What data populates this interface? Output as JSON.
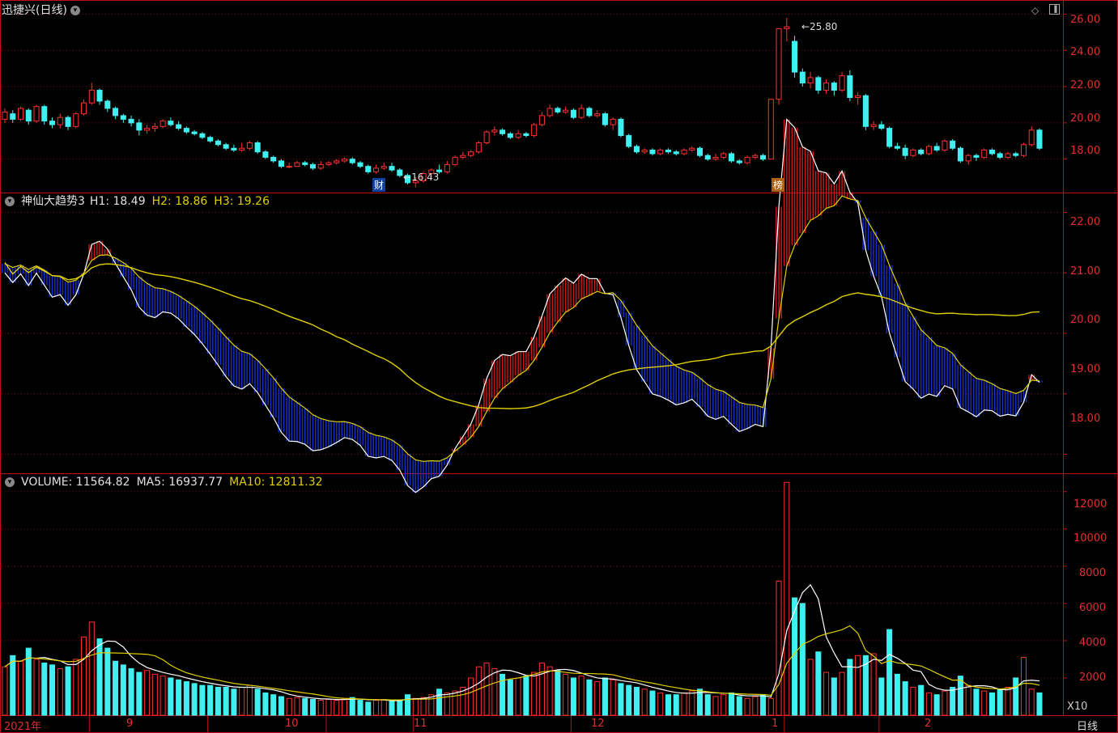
{
  "panel1": {
    "title": "迅捷兴(日线)",
    "high_label": "25.80",
    "low_label": "16.43",
    "markers": [
      {
        "label": "财",
        "color": "#2060c0"
      },
      {
        "label": "榜",
        "color": "#c07020"
      }
    ],
    "yticks": [
      "26.00",
      "24.00",
      "22.00",
      "20.00",
      "18.00"
    ]
  },
  "panel2": {
    "title": "神仙大趋势3",
    "h1_label": "H1: 18.49",
    "h2_label": "H2: 18.86",
    "h3_label": "H3: 19.26",
    "yticks": [
      "22.00",
      "21.00",
      "20.00",
      "19.00",
      "18.00"
    ]
  },
  "panel3": {
    "vol_label": "VOLUME: 11564.82",
    "ma5_label": "MA5: 16937.77",
    "ma10_label": "MA10: 12811.32",
    "yticks": [
      "12000",
      "10000",
      "8000",
      "6000",
      "4000",
      "2000"
    ],
    "unit": "X10"
  },
  "xaxis": {
    "labels": [
      "2021年",
      "9",
      "10",
      "11",
      "12",
      "1",
      "2"
    ],
    "period": "日线"
  },
  "colors": {
    "up": "#ff3030",
    "down": "#40f0f0",
    "ma10": "#e0d000",
    "grid": "#801010",
    "axis": "#c01010"
  },
  "chart_data": {
    "type": "candlestick",
    "candles": [
      [
        20.2,
        20.6,
        20.8,
        20.0
      ],
      [
        20.5,
        20.2,
        20.7,
        20.0
      ],
      [
        20.2,
        20.8,
        20.9,
        20.1
      ],
      [
        20.7,
        20.1,
        20.8,
        19.9
      ],
      [
        20.1,
        20.9,
        21.0,
        20.0
      ],
      [
        20.9,
        20.1,
        21.0,
        19.9
      ],
      [
        20.1,
        19.9,
        20.3,
        19.7
      ],
      [
        19.9,
        20.3,
        20.5,
        19.7
      ],
      [
        20.3,
        19.8,
        20.4,
        19.6
      ],
      [
        19.8,
        20.5,
        20.6,
        19.7
      ],
      [
        20.5,
        21.1,
        21.3,
        20.4
      ],
      [
        21.1,
        21.8,
        22.2,
        21.0
      ],
      [
        21.8,
        21.2,
        21.9,
        21.0
      ],
      [
        21.2,
        20.8,
        21.3,
        20.6
      ],
      [
        20.8,
        20.4,
        20.9,
        20.2
      ],
      [
        20.4,
        20.2,
        20.5,
        20.0
      ],
      [
        20.2,
        20.0,
        20.4,
        19.8
      ],
      [
        20.0,
        19.6,
        20.2,
        19.3
      ],
      [
        19.6,
        19.7,
        19.9,
        19.4
      ],
      [
        19.7,
        19.8,
        20.0,
        19.5
      ],
      [
        19.8,
        20.1,
        20.2,
        19.7
      ],
      [
        20.1,
        19.9,
        20.3,
        19.8
      ],
      [
        19.9,
        19.7,
        20.1,
        19.6
      ],
      [
        19.7,
        19.5,
        19.8,
        19.4
      ],
      [
        19.5,
        19.4,
        19.6,
        19.3
      ],
      [
        19.4,
        19.2,
        19.5,
        19.1
      ],
      [
        19.2,
        19.0,
        19.3,
        18.9
      ],
      [
        19.0,
        18.8,
        19.1,
        18.7
      ],
      [
        18.8,
        18.6,
        18.9,
        18.5
      ],
      [
        18.6,
        18.5,
        18.8,
        18.4
      ],
      [
        18.5,
        18.6,
        18.9,
        18.4
      ],
      [
        18.6,
        18.9,
        19.0,
        18.5
      ],
      [
        18.9,
        18.4,
        19.0,
        18.3
      ],
      [
        18.4,
        18.1,
        18.5,
        18.0
      ],
      [
        18.1,
        17.9,
        18.2,
        17.8
      ],
      [
        17.9,
        17.6,
        18.0,
        17.5
      ],
      [
        17.6,
        17.6,
        17.8,
        17.5
      ],
      [
        17.6,
        17.8,
        17.9,
        17.6
      ],
      [
        17.8,
        17.7,
        17.9,
        17.6
      ],
      [
        17.7,
        17.5,
        17.8,
        17.4
      ],
      [
        17.5,
        17.7,
        17.9,
        17.4
      ],
      [
        17.7,
        17.8,
        17.9,
        17.6
      ],
      [
        17.8,
        17.9,
        18.0,
        17.7
      ],
      [
        17.9,
        18.0,
        18.1,
        17.8
      ],
      [
        18.0,
        17.8,
        18.1,
        17.7
      ],
      [
        17.8,
        17.6,
        17.9,
        17.5
      ],
      [
        17.6,
        17.3,
        17.7,
        17.2
      ],
      [
        17.3,
        17.5,
        17.7,
        17.2
      ],
      [
        17.5,
        17.6,
        17.8,
        17.4
      ],
      [
        17.6,
        17.4,
        17.8,
        17.3
      ],
      [
        17.4,
        17.1,
        17.5,
        17.0
      ],
      [
        17.1,
        16.7,
        17.2,
        16.6
      ],
      [
        16.7,
        16.8,
        17.0,
        16.43
      ],
      [
        16.8,
        17.2,
        17.3,
        16.7
      ],
      [
        17.2,
        17.4,
        17.5,
        17.0
      ],
      [
        17.4,
        17.3,
        17.7,
        17.2
      ],
      [
        17.3,
        17.7,
        17.9,
        17.2
      ],
      [
        17.7,
        18.1,
        18.2,
        17.6
      ],
      [
        18.1,
        18.2,
        18.4,
        18.0
      ],
      [
        18.2,
        18.4,
        18.5,
        18.1
      ],
      [
        18.4,
        18.9,
        19.0,
        18.3
      ],
      [
        18.9,
        19.5,
        19.6,
        18.8
      ],
      [
        19.5,
        19.6,
        19.8,
        19.3
      ],
      [
        19.6,
        19.4,
        19.7,
        19.3
      ],
      [
        19.4,
        19.2,
        19.5,
        19.1
      ],
      [
        19.2,
        19.4,
        19.6,
        19.1
      ],
      [
        19.4,
        19.3,
        19.5,
        19.2
      ],
      [
        19.3,
        19.9,
        20.0,
        19.2
      ],
      [
        19.9,
        20.4,
        20.6,
        19.8
      ],
      [
        20.4,
        20.8,
        21.0,
        20.3
      ],
      [
        20.8,
        20.6,
        20.9,
        20.5
      ],
      [
        20.6,
        20.7,
        20.9,
        20.5
      ],
      [
        20.7,
        20.3,
        20.8,
        20.2
      ],
      [
        20.3,
        20.8,
        21.0,
        20.2
      ],
      [
        20.8,
        20.4,
        20.9,
        20.3
      ],
      [
        20.4,
        20.5,
        20.7,
        20.3
      ],
      [
        20.5,
        19.9,
        20.6,
        19.8
      ],
      [
        19.9,
        20.2,
        20.3,
        19.6
      ],
      [
        20.2,
        19.3,
        20.3,
        19.2
      ],
      [
        19.3,
        18.7,
        19.4,
        18.6
      ],
      [
        18.7,
        18.4,
        18.8,
        18.3
      ],
      [
        18.4,
        18.5,
        18.6,
        18.3
      ],
      [
        18.5,
        18.3,
        18.6,
        18.2
      ],
      [
        18.3,
        18.5,
        18.6,
        18.2
      ],
      [
        18.5,
        18.4,
        18.6,
        18.3
      ],
      [
        18.4,
        18.3,
        18.5,
        18.2
      ],
      [
        18.3,
        18.5,
        18.6,
        18.2
      ],
      [
        18.5,
        18.6,
        18.7,
        18.4
      ],
      [
        18.6,
        18.2,
        18.7,
        18.1
      ],
      [
        18.2,
        18.0,
        18.3,
        17.9
      ],
      [
        18.0,
        18.1,
        18.3,
        17.9
      ],
      [
        18.1,
        18.3,
        18.4,
        18.0
      ],
      [
        18.3,
        17.9,
        18.4,
        17.8
      ],
      [
        17.9,
        17.8,
        18.0,
        17.7
      ],
      [
        17.8,
        18.1,
        18.2,
        17.7
      ],
      [
        18.1,
        18.2,
        18.3,
        18.0
      ],
      [
        18.2,
        18.0,
        18.3,
        17.9
      ],
      [
        18.0,
        21.3,
        21.3,
        18.0
      ],
      [
        21.3,
        25.2,
        25.2,
        21.0
      ],
      [
        25.2,
        25.3,
        25.8,
        24.5
      ],
      [
        24.5,
        22.8,
        24.8,
        22.5
      ],
      [
        22.8,
        22.2,
        23.0,
        22.0
      ],
      [
        22.2,
        22.5,
        22.8,
        21.9
      ],
      [
        22.5,
        21.8,
        22.6,
        21.6
      ],
      [
        21.8,
        22.2,
        22.4,
        21.6
      ],
      [
        22.2,
        21.8,
        22.3,
        21.5
      ],
      [
        21.8,
        22.6,
        22.8,
        21.7
      ],
      [
        22.6,
        21.4,
        22.9,
        21.2
      ],
      [
        21.4,
        21.5,
        21.7,
        21.0
      ],
      [
        21.5,
        19.8,
        21.6,
        19.6
      ],
      [
        19.8,
        19.9,
        20.1,
        19.6
      ],
      [
        19.9,
        19.7,
        20.1,
        19.6
      ],
      [
        19.7,
        18.7,
        19.8,
        18.6
      ],
      [
        18.7,
        18.6,
        18.9,
        18.5
      ],
      [
        18.6,
        18.2,
        18.8,
        18.0
      ],
      [
        18.2,
        18.5,
        18.6,
        18.1
      ],
      [
        18.5,
        18.3,
        18.6,
        18.2
      ],
      [
        18.3,
        18.7,
        18.8,
        18.2
      ],
      [
        18.7,
        18.5,
        18.9,
        18.4
      ],
      [
        18.5,
        19.0,
        19.1,
        18.4
      ],
      [
        19.0,
        18.6,
        19.1,
        18.5
      ],
      [
        18.6,
        17.9,
        18.7,
        17.8
      ],
      [
        17.9,
        18.2,
        18.3,
        17.7
      ],
      [
        18.2,
        18.1,
        18.3,
        17.9
      ],
      [
        18.1,
        18.5,
        18.6,
        18.0
      ],
      [
        18.5,
        18.3,
        18.6,
        18.2
      ],
      [
        18.3,
        18.1,
        18.4,
        18.0
      ],
      [
        18.1,
        18.3,
        18.4,
        18.0
      ],
      [
        18.3,
        18.2,
        18.4,
        18.1
      ],
      [
        18.2,
        18.8,
        18.9,
        18.1
      ],
      [
        18.8,
        19.6,
        19.8,
        18.7
      ],
      [
        19.6,
        18.6,
        19.7,
        18.5
      ]
    ],
    "volumes": [
      260,
      320,
      290,
      360,
      300,
      280,
      270,
      250,
      260,
      300,
      420,
      500,
      410,
      360,
      290,
      270,
      250,
      230,
      240,
      220,
      210,
      200,
      190,
      180,
      170,
      160,
      160,
      150,
      150,
      140,
      150,
      160,
      140,
      120,
      110,
      100,
      90,
      95,
      90,
      85,
      80,
      85,
      80,
      90,
      95,
      80,
      70,
      80,
      85,
      75,
      80,
      110,
      90,
      95,
      110,
      140,
      120,
      130,
      150,
      200,
      260,
      280,
      250,
      220,
      190,
      200,
      210,
      230,
      280,
      260,
      240,
      220,
      200,
      210,
      190,
      180,
      200,
      190,
      170,
      160,
      150,
      140,
      130,
      120,
      110,
      110,
      120,
      130,
      140,
      110,
      100,
      110,
      120,
      100,
      90,
      100,
      110,
      90,
      720,
      1250,
      630,
      600,
      300,
      340,
      230,
      200,
      230,
      300,
      320,
      320,
      330,
      200,
      460,
      220,
      180,
      150,
      160,
      120,
      110,
      130,
      150,
      210,
      160,
      140,
      130,
      120,
      140,
      150,
      200,
      310,
      140,
      120
    ],
    "panel2_yrange": [
      17.7,
      22.3
    ],
    "panel1_yrange": [
      16.2,
      26.6
    ],
    "panel3_yrange": [
      0,
      12900
    ],
    "month_starts": [
      0,
      11,
      26,
      41,
      52,
      72,
      99,
      111
    ]
  }
}
